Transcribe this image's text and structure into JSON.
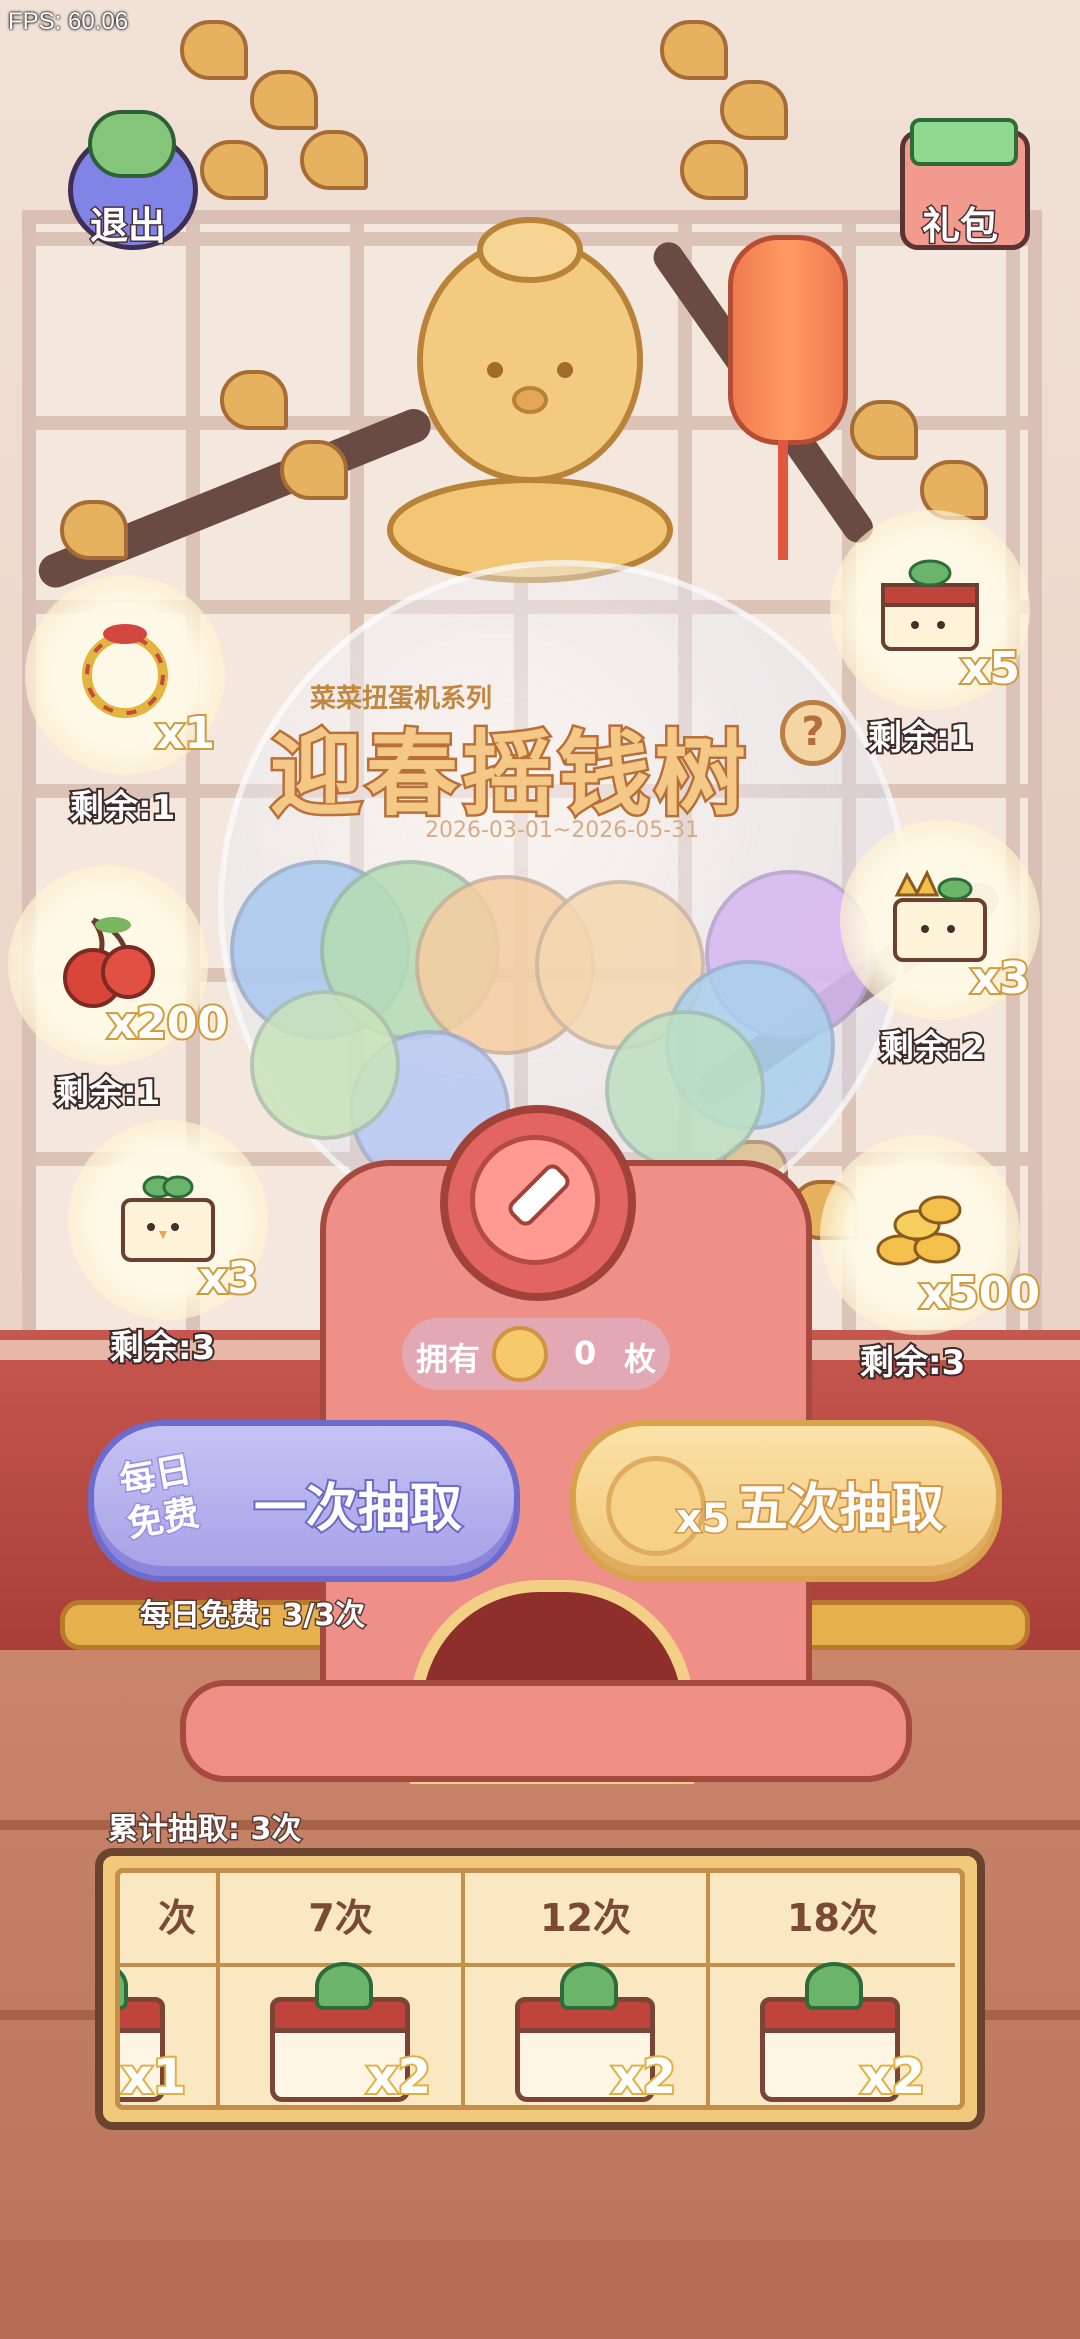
{
  "fps": "FPS: 60.06",
  "top_buttons": {
    "exit": "退出",
    "gift": "礼包"
  },
  "event": {
    "series": "菜菜扭蛋机系列",
    "title": "迎春摇钱树",
    "date_range": "2026-03-01~2026-05-31",
    "help": "?"
  },
  "prizes_left": [
    {
      "icon": "lucky-ring-icon",
      "count": "x1",
      "remain": "剩余:1"
    },
    {
      "icon": "cherry-icon",
      "count": "x200",
      "remain": "剩余:1"
    },
    {
      "icon": "sprout-box-icon",
      "count": "x3",
      "remain": "剩余:3"
    }
  ],
  "prizes_right": [
    {
      "icon": "treasure-chest-icon",
      "count": "x5",
      "remain": "剩余:1"
    },
    {
      "icon": "crown-box-icon",
      "count": "x3",
      "remain": "剩余:2"
    },
    {
      "icon": "gold-coins-icon",
      "count": "x500",
      "remain": "剩余:3"
    }
  ],
  "owned": {
    "label": "拥有",
    "value": "0",
    "unit": "枚"
  },
  "draw_once": {
    "badge_line1": "每日",
    "badge_line2": "免费",
    "label": "一次抽取"
  },
  "draw_five": {
    "multiplier": "x5",
    "label": "五次抽取"
  },
  "daily_free": "每日免费: 3/3次",
  "cumulative": {
    "label": "累计抽取: 3次",
    "milestones": [
      {
        "head": "次",
        "count": "x1"
      },
      {
        "head": "7次",
        "count": "x2"
      },
      {
        "head": "12次",
        "count": "x2"
      },
      {
        "head": "18次",
        "count": "x2"
      }
    ]
  },
  "colors": {
    "accent_purple": "#6d6ccd",
    "accent_gold": "#d9a24e",
    "machine_red": "#ee8f88"
  }
}
